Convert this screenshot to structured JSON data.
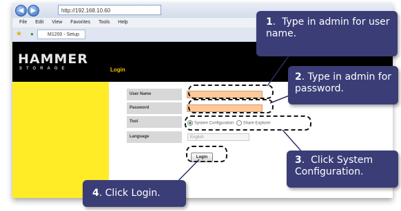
{
  "browser": {
    "address": "http://192.168.10.60",
    "menu": [
      "File",
      "Edit",
      "View",
      "Favorites",
      "Tools",
      "Help"
    ],
    "tab_title": "M1200 - Setup"
  },
  "brand": {
    "name": "HAMMER",
    "sub": "STORAGE"
  },
  "login": {
    "heading": "Login",
    "fields": {
      "user_name_label": "User Name",
      "password_label": "Password",
      "tool_label": "Tool",
      "language_label": "Language"
    },
    "tool_options": [
      "System Configuration",
      "Share Explorer"
    ],
    "tool_selected": "System Configuration",
    "language_value": "English",
    "button_label": "Login"
  },
  "callouts": [
    {
      "number": "1",
      "text": "Type in admin for user name."
    },
    {
      "number": "2",
      "text": "Type in admin for password."
    },
    {
      "number": "3",
      "text": "Click System Configuration."
    },
    {
      "number": "4",
      "text": "Click Login."
    }
  ],
  "colors": {
    "callout": "#3b3d77",
    "sidebar": "#ffec26",
    "input": "#fcc99a"
  }
}
